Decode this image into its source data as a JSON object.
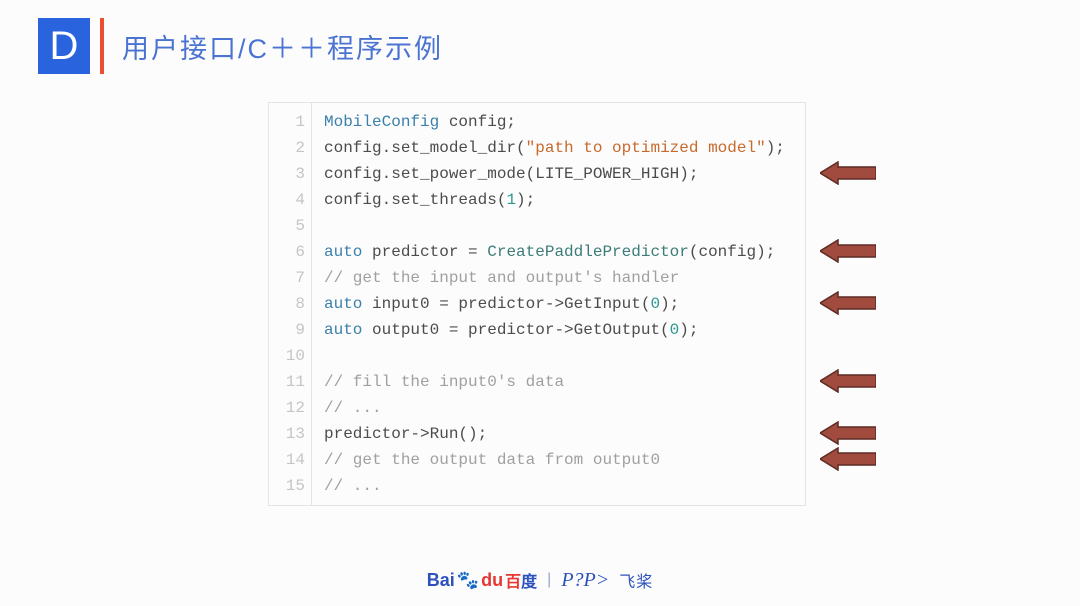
{
  "header": {
    "badge": "D",
    "title": "用户接口/C＋＋程序示例"
  },
  "code": {
    "lines": [
      {
        "n": 1,
        "tokens": [
          [
            "type",
            "MobileConfig"
          ],
          [
            "plain",
            " config;"
          ]
        ]
      },
      {
        "n": 2,
        "tokens": [
          [
            "plain",
            "config.set_model_dir("
          ],
          [
            "str",
            "\"path to optimized model\""
          ],
          [
            "plain",
            ");"
          ]
        ]
      },
      {
        "n": 3,
        "tokens": [
          [
            "plain",
            "config.set_power_mode(LITE_POWER_HIGH);"
          ]
        ]
      },
      {
        "n": 4,
        "tokens": [
          [
            "plain",
            "config.set_threads("
          ],
          [
            "num",
            "1"
          ],
          [
            "plain",
            ");"
          ]
        ]
      },
      {
        "n": 5,
        "tokens": [
          [
            "plain",
            ""
          ]
        ]
      },
      {
        "n": 6,
        "tokens": [
          [
            "type",
            "auto"
          ],
          [
            "plain",
            " predictor = "
          ],
          [
            "func",
            "CreatePaddlePredictor"
          ],
          [
            "plain",
            "(config);"
          ]
        ]
      },
      {
        "n": 7,
        "tokens": [
          [
            "cmt",
            "// get the input and output's handler"
          ]
        ]
      },
      {
        "n": 8,
        "tokens": [
          [
            "type",
            "auto"
          ],
          [
            "plain",
            " input0 = predictor->GetInput("
          ],
          [
            "num",
            "0"
          ],
          [
            "plain",
            ");"
          ]
        ]
      },
      {
        "n": 9,
        "tokens": [
          [
            "type",
            "auto"
          ],
          [
            "plain",
            " output0 = predictor->GetOutput("
          ],
          [
            "num",
            "0"
          ],
          [
            "plain",
            ");"
          ]
        ]
      },
      {
        "n": 10,
        "tokens": [
          [
            "plain",
            ""
          ]
        ]
      },
      {
        "n": 11,
        "tokens": [
          [
            "cmt",
            "// fill the input0's data"
          ]
        ]
      },
      {
        "n": 12,
        "tokens": [
          [
            "cmt",
            "// ..."
          ]
        ]
      },
      {
        "n": 13,
        "tokens": [
          [
            "plain",
            "predictor->Run();"
          ]
        ]
      },
      {
        "n": 14,
        "tokens": [
          [
            "cmt",
            "// get the output data from output0"
          ]
        ]
      },
      {
        "n": 15,
        "tokens": [
          [
            "cmt",
            "// ..."
          ]
        ]
      }
    ]
  },
  "arrows": {
    "targets_line": [
      3,
      6,
      8,
      11,
      13,
      14
    ],
    "color_fill": "#a04b3e",
    "color_stroke": "#5d2b24"
  },
  "footer": {
    "baidu_lat1": "Bai",
    "baidu_lat2": "du",
    "baidu_cn1": "百",
    "baidu_cn2": "度",
    "pp": "P?P>",
    "feijiang": "飞桨"
  }
}
